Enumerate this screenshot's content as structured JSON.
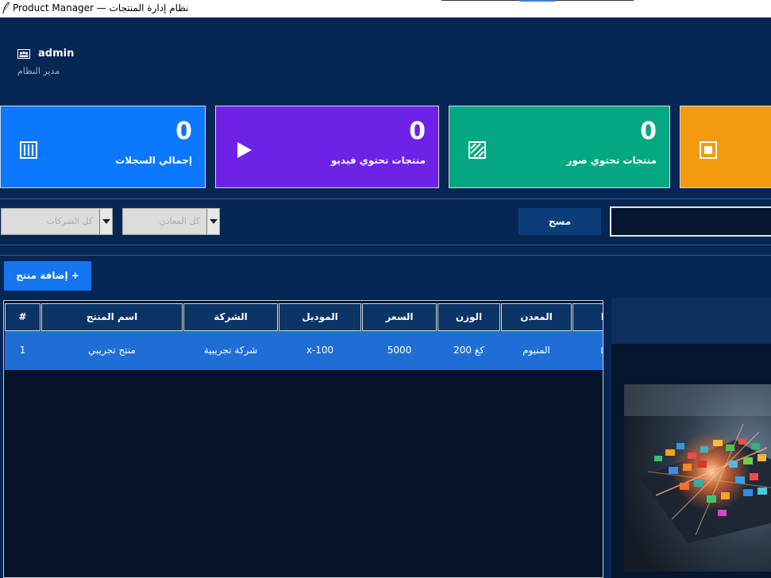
{
  "window": {
    "title": "Product Manager — نظام إدارة المنتجات"
  },
  "user": {
    "name": "admin",
    "role": "مدير النظام",
    "icon": "users-icon"
  },
  "stats": [
    {
      "value": "0",
      "label": "إجمالي السجلات",
      "color": "#0b78ff",
      "icon": "barcode-icon"
    },
    {
      "value": "0",
      "label": "منتجات تحتوي فيديو",
      "color": "#6e22e8",
      "icon": "play-icon"
    },
    {
      "value": "0",
      "label": "منتجات تحتوي صور",
      "color": "#03a882",
      "icon": "image-icon"
    },
    {
      "value": "",
      "label": "",
      "color": "#f39a0d",
      "icon": "square-icon"
    }
  ],
  "filters": {
    "companies": "كل الشركات",
    "metals": "كل المعادن",
    "clear_label": "مسح",
    "search_value": ""
  },
  "actions": {
    "add_label": "إضافة منتج +"
  },
  "table": {
    "columns": [
      "#",
      "اسم المنتج",
      "الشركة",
      "الموديل",
      "السعر",
      "الوزن",
      "المعدن",
      "ا"
    ],
    "rows": [
      {
        "num": "1",
        "name": "منتج تجريبي",
        "company": "شركة تجريبية",
        "model": "x-100",
        "price": "5000",
        "weight": "200 كغ",
        "metal": "المنيوم",
        "media": "▧"
      }
    ]
  },
  "preview": {
    "image": "product-preview-image"
  }
}
